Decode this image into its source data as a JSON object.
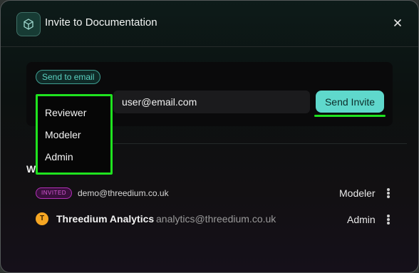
{
  "modal": {
    "title": "Invite to Documentation"
  },
  "invite": {
    "tag": "Send to email",
    "email_value": "user@email.com",
    "send_label": "Send Invite"
  },
  "role_options": [
    "Reviewer",
    "Modeler",
    "Admin"
  ],
  "members_section": {
    "title_visible": "W"
  },
  "members": [
    {
      "badge": "INVITED",
      "email": "demo@threedium.co.uk",
      "role": "Modeler"
    },
    {
      "avatar_letter": "T",
      "name": "Threedium Analytics",
      "email": "analytics@threedium.co.uk",
      "role": "Admin"
    }
  ],
  "colors": {
    "accent": "#5fd8cc",
    "highlight": "#1fe31f",
    "invited_badge": "#d95ad8",
    "avatar": "#f5a623"
  }
}
